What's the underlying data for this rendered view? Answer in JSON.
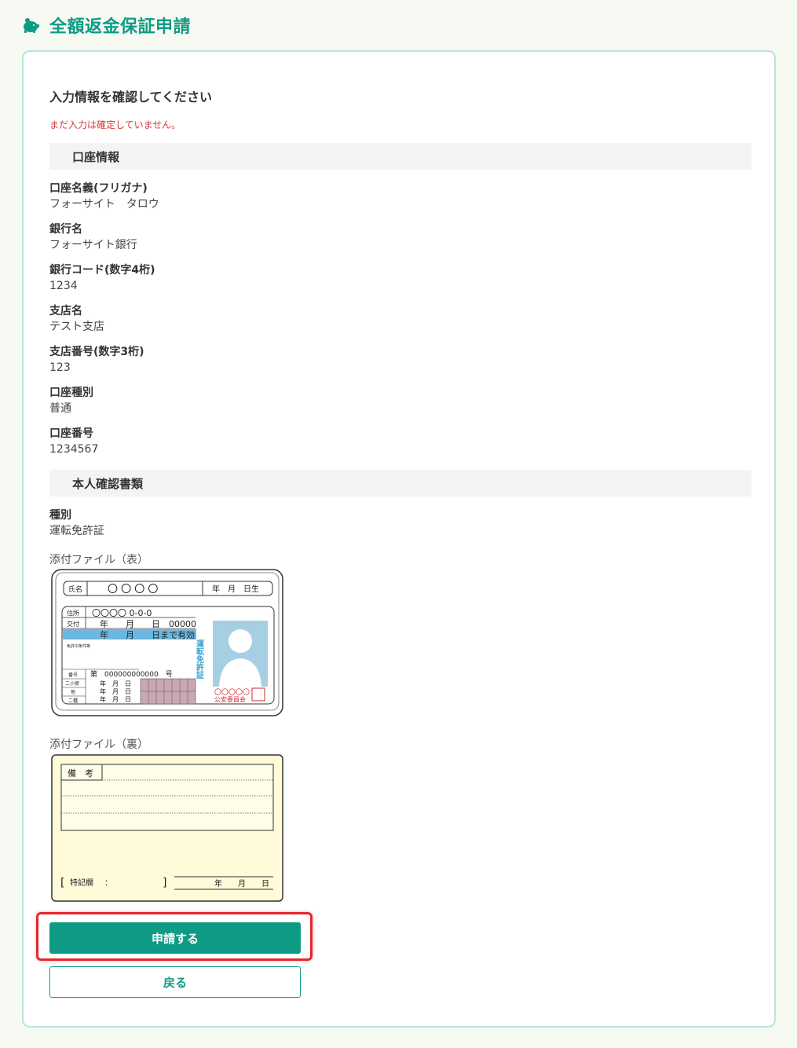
{
  "header": {
    "title": "全額返金保証申請",
    "icon": "piggy-bank-icon",
    "accent_color": "#0e9b85"
  },
  "confirm": {
    "heading": "入力情報を確認してください",
    "notice": "まだ入力は確定していません。"
  },
  "account_section": {
    "title": "口座情報",
    "fields": [
      {
        "label": "口座名義(フリガナ)",
        "value": "フォーサイト　タロウ"
      },
      {
        "label": "銀行名",
        "value": "フォーサイト銀行"
      },
      {
        "label": "銀行コード(数字4桁)",
        "value": "1234"
      },
      {
        "label": "支店名",
        "value": "テスト支店"
      },
      {
        "label": "支店番号(数字3桁)",
        "value": "123"
      },
      {
        "label": "口座種別",
        "value": "普通"
      },
      {
        "label": "口座番号",
        "value": "1234567"
      }
    ]
  },
  "identity_section": {
    "title": "本人確認書類",
    "type_label": "種別",
    "type_value": "運転免許証",
    "front_label": "添付ファイル（表）",
    "back_label": "添付ファイル（裏）",
    "front_card": {
      "name_label": "氏名",
      "name_value": "〇 〇 〇 〇",
      "birth": "年　月　日生",
      "address_label": "住所",
      "address_value": "〇〇〇〇 0-0-0",
      "issue_label": "交付",
      "issue_value": "年　　月　　日　00000",
      "valid_until": "年　　月　　日まで有効",
      "conditions_label": "免許の条件等",
      "number_label": "番号",
      "number_value": "第　000000000000　号",
      "class_labels": [
        "二小原",
        "他",
        "二種"
      ],
      "date_rows": "年　月　日",
      "vertical_title": "運転免許証",
      "authority": "〇〇〇〇〇",
      "authority_name": "公安委員会"
    },
    "back_card": {
      "remarks_label": "備　考",
      "special_label": "特記欄",
      "colon": "：",
      "date": "年　　月　　日"
    }
  },
  "actions": {
    "submit_label": "申請する",
    "back_label": "戻る"
  }
}
